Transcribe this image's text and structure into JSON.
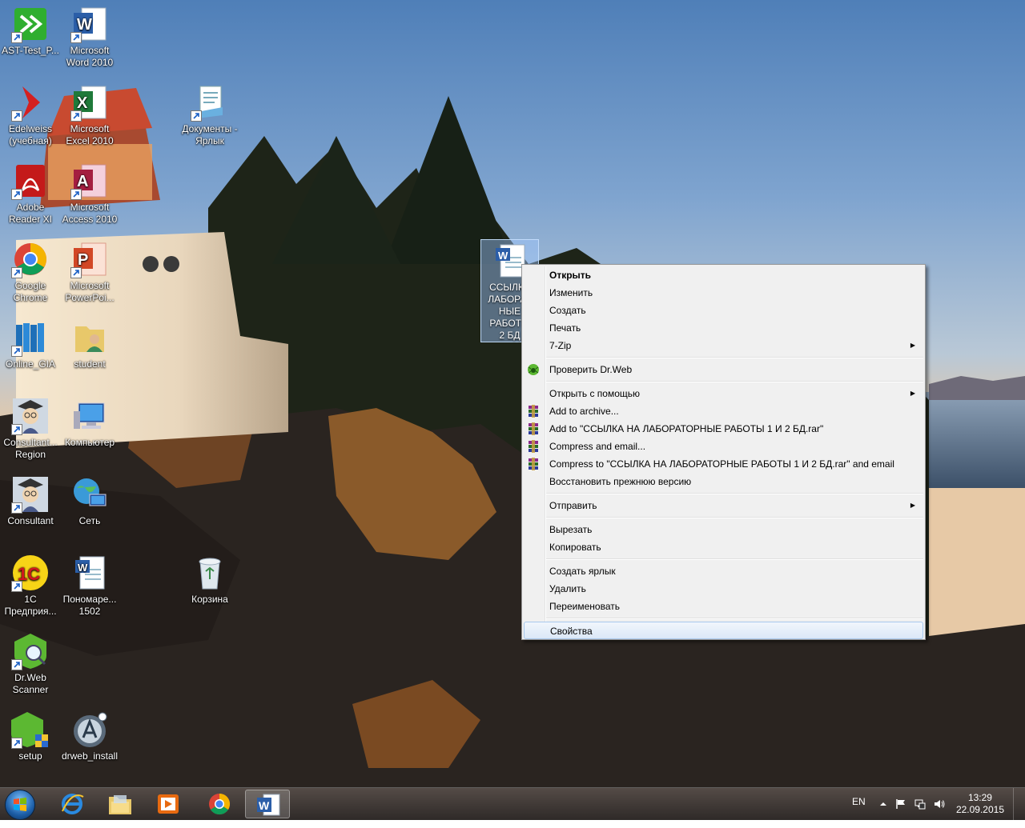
{
  "desktop": {
    "icons": [
      {
        "id": "ast",
        "label": "AST-Test_P...",
        "icon": "ast-icon"
      },
      {
        "id": "word",
        "label": "Microsoft\nWord 2010",
        "icon": "word-icon"
      },
      {
        "id": "edelweiss",
        "label": "Edelweiss\n(учебная)",
        "icon": "edelweiss-icon"
      },
      {
        "id": "excel",
        "label": "Microsoft\nExcel 2010",
        "icon": "excel-icon"
      },
      {
        "id": "docs",
        "label": "Документы -\nЯрлык",
        "icon": "documents-icon"
      },
      {
        "id": "adobe",
        "label": "Adobe\nReader XI",
        "icon": "adobe-reader-icon"
      },
      {
        "id": "access",
        "label": "Microsoft\nAccess 2010",
        "icon": "access-icon"
      },
      {
        "id": "chrome",
        "label": "Google\nChrome",
        "icon": "chrome-icon"
      },
      {
        "id": "ppt",
        "label": "Microsoft\nPowerPoi...",
        "icon": "powerpoint-icon"
      },
      {
        "id": "gia",
        "label": "Online_GIA",
        "icon": "books-icon"
      },
      {
        "id": "student",
        "label": "student",
        "icon": "user-folder-icon"
      },
      {
        "id": "consregion",
        "label": "Consultant...\nRegion",
        "icon": "consultant-icon"
      },
      {
        "id": "computer",
        "label": "Компьютер",
        "icon": "computer-icon"
      },
      {
        "id": "consultant",
        "label": "Consultant",
        "icon": "consultant-icon"
      },
      {
        "id": "network",
        "label": "Сеть",
        "icon": "network-icon"
      },
      {
        "id": "1c",
        "label": "1С\nПредприя...",
        "icon": "1c-icon"
      },
      {
        "id": "ponomar",
        "label": "Пономаре...\n1502",
        "icon": "word-doc-icon"
      },
      {
        "id": "trash",
        "label": "Корзина",
        "icon": "recycle-bin-icon"
      },
      {
        "id": "drwebscan",
        "label": "Dr.Web\nScanner",
        "icon": "drweb-scanner-icon"
      },
      {
        "id": "setup",
        "label": "setup",
        "icon": "setup-icon"
      },
      {
        "id": "drwebinstall",
        "label": "drweb_install",
        "icon": "drweb-install-icon"
      }
    ],
    "selected_file": {
      "label": "ССЫЛКА\nЛАБОРАТ\nНЫЕ\nРАБОТЫ\n2 БД",
      "icon": "word-doc-icon"
    }
  },
  "context_menu": {
    "items": [
      {
        "label": "Открыть",
        "bold": true
      },
      {
        "label": "Изменить"
      },
      {
        "label": "Создать"
      },
      {
        "label": "Печать"
      },
      {
        "label": "7-Zip",
        "submenu": true
      },
      {
        "label": "Проверить Dr.Web",
        "icon": "drweb-spider-icon"
      },
      {
        "label": "Открыть с помощью",
        "submenu": true
      },
      {
        "label": "Add to archive...",
        "icon": "winrar-icon"
      },
      {
        "label": "Add to \"ССЫЛКА НА ЛАБОРАТОРНЫЕ РАБОТЫ 1 И 2 БД.rar\"",
        "icon": "winrar-icon"
      },
      {
        "label": "Compress and email...",
        "icon": "winrar-icon"
      },
      {
        "label": "Compress to \"ССЫЛКА НА ЛАБОРАТОРНЫЕ РАБОТЫ 1 И 2 БД.rar\" and email",
        "icon": "winrar-icon"
      },
      {
        "label": "Восстановить прежнюю версию"
      },
      {
        "label": "Отправить",
        "submenu": true
      },
      {
        "label": "Вырезать"
      },
      {
        "label": "Копировать"
      },
      {
        "label": "Создать ярлык"
      },
      {
        "label": "Удалить"
      },
      {
        "label": "Переименовать"
      },
      {
        "label": "Свойства",
        "hover": true
      }
    ],
    "submenu_arrow": "▶"
  },
  "taskbar": {
    "pinned": [
      "internet-explorer-icon",
      "explorer-folder-icon",
      "media-player-icon",
      "chrome-icon",
      "word-icon"
    ],
    "language": "EN",
    "time": "13:29",
    "date": "22.09.2015",
    "tray_icons": [
      "show-hidden-icon",
      "action-center-flag-icon",
      "network-icon",
      "volume-icon"
    ]
  }
}
